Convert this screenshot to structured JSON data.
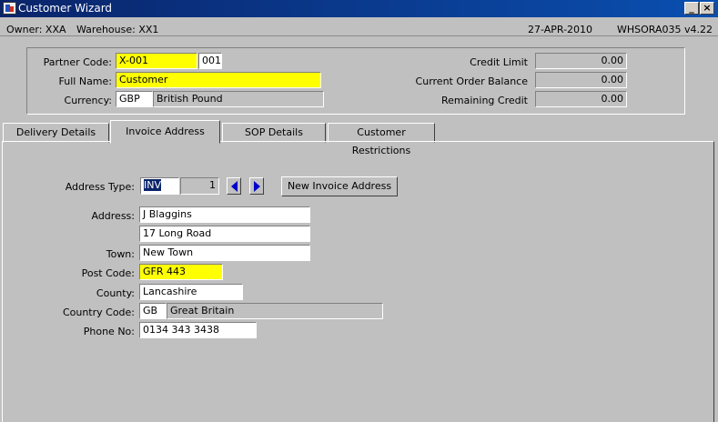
{
  "window": {
    "title": "Customer Wizard",
    "minimize_glyph": "_",
    "close_glyph": "×"
  },
  "infobar": {
    "owner": "Owner:  XXA",
    "warehouse": "Warehouse:  XX1",
    "date": "27-APR-2010",
    "version": "WHSORA035  v4.22"
  },
  "header": {
    "partner_code_label": "Partner Code:",
    "partner_code": "X-001",
    "partner_suffix": "001",
    "full_name_label": "Full Name:",
    "full_name": "Customer",
    "currency_label": "Currency:",
    "currency_code": "GBP",
    "currency_name": "British Pound",
    "credit_limit_label": "Credit Limit",
    "credit_limit": "0.00",
    "current_order_balance_label": "Current Order Balance",
    "current_order_balance": "0.00",
    "remaining_credit_label": "Remaining Credit",
    "remaining_credit": "0.00"
  },
  "tabs": [
    {
      "label": "Delivery Details"
    },
    {
      "label": "Invoice Address"
    },
    {
      "label": "SOP Details"
    },
    {
      "label": "Customer Restrictions"
    }
  ],
  "invoice": {
    "address_type_label": "Address Type:",
    "address_type": "INV",
    "address_seq": "1",
    "new_address_button": "New Invoice Address",
    "address_label": "Address:",
    "address_line1": "J Blaggins",
    "address_line2": "17 Long Road",
    "town_label": "Town:",
    "town": "New Town",
    "post_code_label": "Post Code:",
    "post_code": "GFR 443",
    "county_label": "County:",
    "county": "Lancashire",
    "country_code_label": "Country Code:",
    "country_code": "GB",
    "country_name": "Great Britain",
    "phone_label": "Phone No:",
    "phone": "0134 343 3438"
  }
}
